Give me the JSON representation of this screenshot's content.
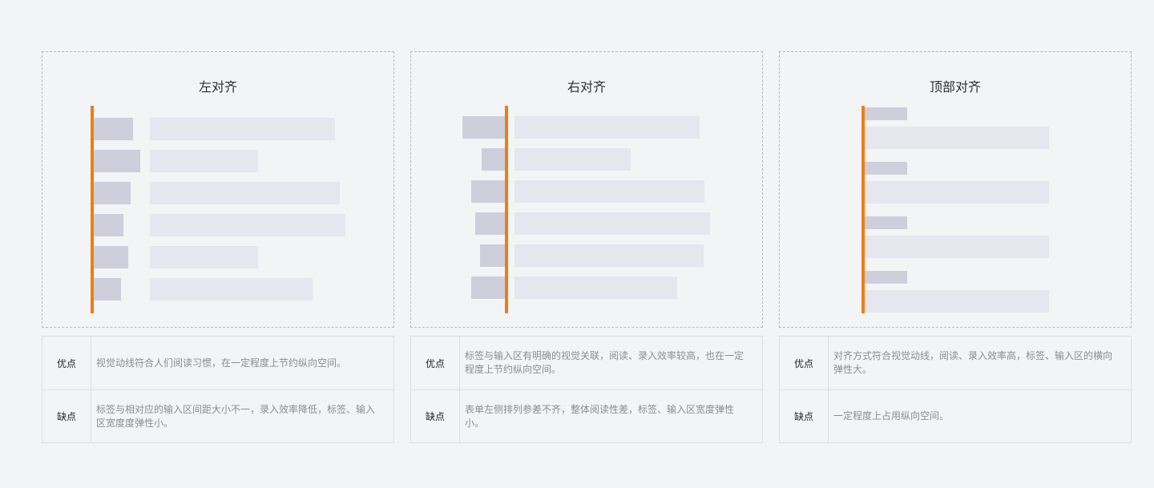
{
  "panels": [
    {
      "title": "左对齐",
      "pros_label": "优点",
      "pros": "视觉动线符合人们阅读习惯，在一定程度上节约纵向空间。",
      "cons_label": "缺点",
      "cons": "标签与相对应的输入区间距大小不一，录入效率降低，标签、输入区宽度度弹性小。"
    },
    {
      "title": "右对齐",
      "pros_label": "优点",
      "pros": "标签与输入区有明确的视觉关联，阅读、录入效率较高，也在一定程度上节约纵向空间。",
      "cons_label": "缺点",
      "cons": "表单左侧排列参差不齐，整体阅读性差，标签、输入区宽度弹性小。"
    },
    {
      "title": "顶部对齐",
      "pros_label": "优点",
      "pros": "对齐方式符合视觉动线，阅读、录入效率高，标签、输入区的横向弹性大。",
      "cons_label": "缺点",
      "cons": "一定程度上占用纵向空间。"
    }
  ],
  "colors": {
    "accent": "#ef7d14",
    "label_block": "#cfcfdb",
    "input_block": "#e5e6ee",
    "background": "#f3f4f6"
  }
}
